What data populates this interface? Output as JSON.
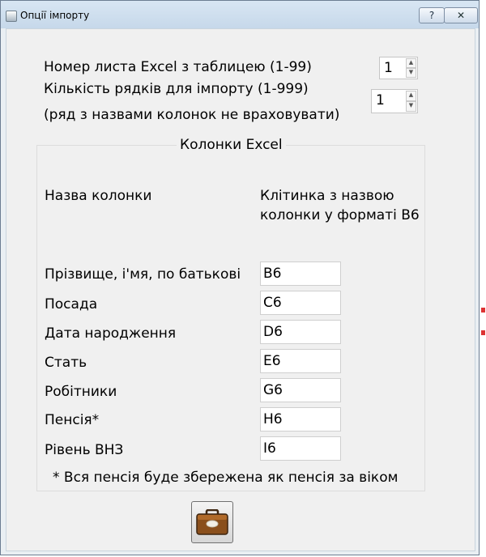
{
  "window": {
    "title": "Опції імпорту",
    "help": "?",
    "close": "✕"
  },
  "sheet": {
    "label": "Номер листа Excel з таблицею (1-99)",
    "value": "1"
  },
  "rows": {
    "label": "Кількість рядків для імпорту (1-999)",
    "note": "(ряд з назвами колонок не враховувати)",
    "value": "1"
  },
  "group": {
    "title": "Колонки Excel",
    "header_name": "Назва колонки",
    "header_cell_line1": "Клітинка з назвою",
    "header_cell_line2": "колонки у форматі В6",
    "fields": [
      {
        "label": "Прізвище, і'мя, по батькові",
        "value": "B6"
      },
      {
        "label": "Посада",
        "value": "C6"
      },
      {
        "label": "Дата народження",
        "value": "D6"
      },
      {
        "label": "Стать",
        "value": "E6"
      },
      {
        "label": "Робітники",
        "value": "G6"
      },
      {
        "label": "Пенсія*",
        "value": "H6"
      },
      {
        "label": "Рівень ВНЗ",
        "value": "I6"
      }
    ],
    "footnote": "* Вся пенсія буде збережена як пенсія за віком"
  },
  "import_button": {
    "icon": "briefcase-icon"
  }
}
